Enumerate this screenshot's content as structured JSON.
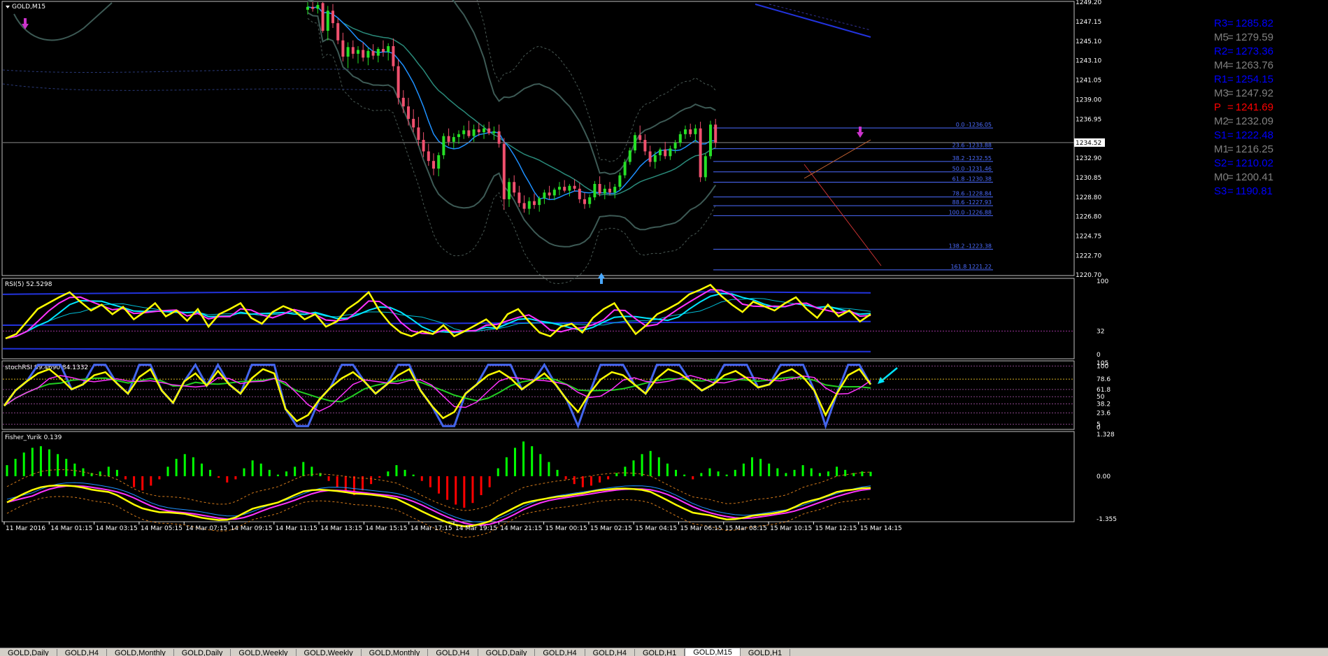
{
  "window": {
    "symbol_label": "GOLD,M15"
  },
  "colors": {
    "background": "#000000",
    "bull_candle": "#26e026",
    "bear_candle": "#f0506e",
    "panel_border": "#c0c0c0",
    "fib": "#4c6cff",
    "pivot_r": "#0000ff",
    "pivot_m": "#808080",
    "pivot_p": "#ff0000",
    "rsi_main": "#ffff00",
    "hist_pos": "#00ff00",
    "hist_neg": "#ff0000"
  },
  "chart_data": [
    {
      "type": "candlestick",
      "title": "GOLD,M15",
      "ylim": [
        1220.7,
        1249.2
      ],
      "y_ticks": [
        "1249.20",
        "1247.15",
        "1245.10",
        "1243.10",
        "1241.05",
        "1239.00",
        "1236.95",
        "1234.52",
        "1232.90",
        "1230.85",
        "1228.80",
        "1226.80",
        "1224.75",
        "1222.70",
        "1220.70"
      ],
      "current_price": "1234.52",
      "grid": false,
      "fib_levels": [
        {
          "label": "0.0 -1236.05",
          "value": 1236.05
        },
        {
          "label": "23.6 -1233.88",
          "value": 1233.88
        },
        {
          "label": "38.2 -1232.55",
          "value": 1232.55
        },
        {
          "label": "50.0 -1231.46",
          "value": 1231.46
        },
        {
          "label": "61.8 -1230.38",
          "value": 1230.38
        },
        {
          "label": "78.6 -1228.84",
          "value": 1228.84
        },
        {
          "label": "88.6 -1227.93",
          "value": 1227.93
        },
        {
          "label": "100.0 -1226.88",
          "value": 1226.88
        },
        {
          "label": "138.2 -1223.38",
          "value": 1223.38
        },
        {
          "label": "161.8 1221.22",
          "value": 1221.22
        }
      ],
      "pivots": [
        {
          "name": "R3",
          "value": "1285.82",
          "kind": "r"
        },
        {
          "name": "M5",
          "value": "1279.59",
          "kind": "m"
        },
        {
          "name": "R2",
          "value": "1273.36",
          "kind": "r"
        },
        {
          "name": "M4",
          "value": "1263.76",
          "kind": "m"
        },
        {
          "name": "R1",
          "value": "1254.15",
          "kind": "r"
        },
        {
          "name": "M3",
          "value": "1247.92",
          "kind": "m"
        },
        {
          "name": "P",
          "value": "1241.69",
          "kind": "p"
        },
        {
          "name": "M2",
          "value": "1232.09",
          "kind": "m"
        },
        {
          "name": "S1",
          "value": "1222.48",
          "kind": "r"
        },
        {
          "name": "M1",
          "value": "1216.25",
          "kind": "m"
        },
        {
          "name": "S2",
          "value": "1210.02",
          "kind": "r"
        },
        {
          "name": "M0",
          "value": "1200.41",
          "kind": "m"
        },
        {
          "name": "S3",
          "value": "1190.81",
          "kind": "r"
        }
      ],
      "candles": [
        [
          1248.4,
          1249.2,
          1247.9,
          1248.7
        ],
        [
          1248.7,
          1249.2,
          1248.2,
          1248.5
        ],
        [
          1248.5,
          1249.2,
          1248.0,
          1248.9
        ],
        [
          1249.1,
          1249.2,
          1246.0,
          1246.2
        ],
        [
          1246.2,
          1248.8,
          1245.2,
          1248.3
        ],
        [
          1248.3,
          1249.0,
          1246.5,
          1247.0
        ],
        [
          1247.0,
          1247.5,
          1244.8,
          1245.2
        ],
        [
          1245.2,
          1246.0,
          1243.0,
          1243.5
        ],
        [
          1243.5,
          1245.0,
          1242.3,
          1244.5
        ],
        [
          1244.5,
          1245.2,
          1243.3,
          1243.8
        ],
        [
          1243.8,
          1244.6,
          1242.8,
          1244.2
        ],
        [
          1244.2,
          1245.0,
          1243.0,
          1243.4
        ],
        [
          1243.4,
          1244.4,
          1242.6,
          1244.1
        ],
        [
          1244.1,
          1244.8,
          1243.2,
          1243.6
        ],
        [
          1243.6,
          1244.5,
          1242.9,
          1244.3
        ],
        [
          1244.3,
          1245.2,
          1243.5,
          1244.0
        ],
        [
          1244.0,
          1244.9,
          1243.1,
          1244.6
        ],
        [
          1244.6,
          1245.4,
          1242.0,
          1242.5
        ],
        [
          1242.5,
          1243.2,
          1238.5,
          1239.2
        ],
        [
          1239.2,
          1240.0,
          1237.6,
          1238.3
        ],
        [
          1238.3,
          1239.2,
          1236.3,
          1237.0
        ],
        [
          1237.0,
          1238.0,
          1235.6,
          1236.1
        ],
        [
          1236.1,
          1237.2,
          1234.2,
          1234.8
        ],
        [
          1234.8,
          1235.6,
          1233.0,
          1233.6
        ],
        [
          1233.6,
          1234.4,
          1232.1,
          1232.6
        ],
        [
          1232.6,
          1233.4,
          1231.1,
          1231.8
        ],
        [
          1231.8,
          1233.5,
          1231.0,
          1233.2
        ],
        [
          1233.2,
          1235.5,
          1232.8,
          1235.2
        ],
        [
          1235.2,
          1236.0,
          1234.2,
          1234.6
        ],
        [
          1234.6,
          1235.5,
          1233.9,
          1235.1
        ],
        [
          1235.1,
          1235.8,
          1234.4,
          1235.4
        ],
        [
          1235.4,
          1236.3,
          1234.9,
          1235.8
        ],
        [
          1235.8,
          1236.8,
          1235.0,
          1235.2
        ],
        [
          1235.2,
          1236.4,
          1234.6,
          1235.9
        ],
        [
          1235.9,
          1236.6,
          1235.2,
          1235.6
        ],
        [
          1235.6,
          1236.4,
          1234.9,
          1236.0
        ],
        [
          1236.0,
          1236.7,
          1235.3,
          1235.5
        ],
        [
          1235.5,
          1236.2,
          1234.8,
          1235.7
        ],
        [
          1235.7,
          1236.4,
          1234.0,
          1234.4
        ],
        [
          1234.4,
          1235.0,
          1227.5,
          1228.6
        ],
        [
          1228.6,
          1230.8,
          1227.8,
          1230.4
        ],
        [
          1230.4,
          1231.1,
          1228.9,
          1229.3
        ],
        [
          1229.3,
          1230.0,
          1227.8,
          1228.2
        ],
        [
          1228.2,
          1229.0,
          1227.2,
          1227.6
        ],
        [
          1227.6,
          1228.8,
          1227.0,
          1228.4
        ],
        [
          1228.4,
          1229.2,
          1227.6,
          1228.0
        ],
        [
          1228.0,
          1228.9,
          1227.3,
          1228.7
        ],
        [
          1228.7,
          1229.6,
          1228.1,
          1229.3
        ],
        [
          1229.3,
          1230.0,
          1228.6,
          1229.0
        ],
        [
          1229.0,
          1229.8,
          1228.5,
          1229.6
        ],
        [
          1229.6,
          1230.4,
          1229.0,
          1229.9
        ],
        [
          1229.9,
          1230.6,
          1229.3,
          1229.5
        ],
        [
          1229.5,
          1230.2,
          1228.9,
          1230.0
        ],
        [
          1230.0,
          1230.7,
          1229.4,
          1229.7
        ],
        [
          1229.7,
          1230.3,
          1228.2,
          1228.6
        ],
        [
          1228.6,
          1229.3,
          1227.6,
          1228.1
        ],
        [
          1228.1,
          1229.1,
          1227.7,
          1228.8
        ],
        [
          1228.8,
          1230.5,
          1228.5,
          1230.2
        ],
        [
          1230.2,
          1231.0,
          1228.9,
          1229.2
        ],
        [
          1229.2,
          1230.1,
          1228.6,
          1229.7
        ],
        [
          1229.7,
          1230.4,
          1229.0,
          1229.3
        ],
        [
          1229.3,
          1230.2,
          1228.7,
          1229.9
        ],
        [
          1229.9,
          1231.4,
          1229.5,
          1231.1
        ],
        [
          1231.1,
          1232.8,
          1230.8,
          1232.5
        ],
        [
          1232.5,
          1234.0,
          1232.2,
          1233.7
        ],
        [
          1233.7,
          1235.6,
          1233.4,
          1235.3
        ],
        [
          1235.3,
          1236.3,
          1234.5,
          1234.8
        ],
        [
          1234.8,
          1235.4,
          1233.2,
          1233.6
        ],
        [
          1233.6,
          1234.2,
          1232.0,
          1232.5
        ],
        [
          1232.5,
          1233.6,
          1231.8,
          1233.2
        ],
        [
          1233.2,
          1234.0,
          1232.6,
          1233.8
        ],
        [
          1233.8,
          1234.6,
          1232.8,
          1233.1
        ],
        [
          1233.1,
          1234.2,
          1232.7,
          1233.9
        ],
        [
          1233.9,
          1234.8,
          1233.4,
          1234.5
        ],
        [
          1234.5,
          1235.7,
          1234.1,
          1235.4
        ],
        [
          1235.4,
          1236.3,
          1234.9,
          1235.9
        ],
        [
          1235.9,
          1236.5,
          1235.1,
          1235.4
        ],
        [
          1235.4,
          1236.4,
          1234.6,
          1236.0
        ],
        [
          1236.0,
          1236.7,
          1230.4,
          1230.9
        ],
        [
          1230.9,
          1233.4,
          1230.5,
          1233.1
        ],
        [
          1233.1,
          1236.8,
          1232.8,
          1236.4
        ],
        [
          1236.4,
          1237.0,
          1234.0,
          1234.5
        ]
      ],
      "x_labels": [
        "11 Mar 2016",
        "14 Mar 01:15",
        "14 Mar 03:15",
        "14 Mar 05:15",
        "14 Mar 07:15",
        "14 Mar 09:15",
        "14 Mar 11:15",
        "14 Mar 13:15",
        "14 Mar 15:15",
        "14 Mar 17:15",
        "14 Mar 19:15",
        "14 Mar 21:15",
        "15 Mar 00:15",
        "15 Mar 02:15",
        "15 Mar 04:15",
        "15 Mar 06:15",
        "15 Mar 08:15",
        "15 Mar 10:15",
        "15 Mar 12:15",
        "15 Mar 14:15"
      ]
    },
    {
      "type": "line",
      "title": "RSI(5) 52.5298",
      "ylim": [
        0,
        100
      ],
      "y_ticks": [
        "100",
        "32",
        "0"
      ],
      "level": 32,
      "values": [
        22,
        28,
        45,
        62,
        70,
        78,
        85,
        72,
        60,
        68,
        55,
        65,
        48,
        58,
        70,
        52,
        60,
        46,
        62,
        38,
        55,
        62,
        70,
        50,
        42,
        58,
        66,
        60,
        48,
        55,
        38,
        45,
        62,
        72,
        85,
        60,
        42,
        30,
        25,
        32,
        28,
        40,
        25,
        32,
        40,
        48,
        35,
        55,
        62,
        45,
        30,
        25,
        38,
        42,
        30,
        50,
        62,
        70,
        48,
        28,
        40,
        55,
        62,
        70,
        82,
        88,
        95,
        80,
        68,
        58,
        72,
        66,
        60,
        70,
        78,
        62,
        50,
        68,
        52,
        60,
        45,
        55
      ]
    },
    {
      "type": "line",
      "title": "stochRSI 89.4690 84.1332",
      "ylim": [
        0,
        105
      ],
      "y_ticks": [
        "105",
        "100",
        "78.6",
        "61.8",
        "50",
        "38.2",
        "23.6",
        "5",
        "0"
      ],
      "values": [
        35,
        60,
        75,
        88,
        95,
        80,
        62,
        70,
        85,
        90,
        72,
        55,
        82,
        95,
        60,
        40,
        75,
        88,
        68,
        92,
        70,
        55,
        80,
        95,
        88,
        30,
        10,
        20,
        45,
        65,
        80,
        90,
        75,
        55,
        70,
        85,
        95,
        60,
        35,
        15,
        25,
        55,
        70,
        85,
        92,
        80,
        62,
        75,
        88,
        70,
        45,
        25,
        55,
        78,
        90,
        85,
        70,
        55,
        80,
        95,
        88,
        75,
        60,
        70,
        85,
        92,
        80,
        65,
        70,
        88,
        95,
        82,
        60,
        20,
        55,
        85,
        95,
        70
      ]
    },
    {
      "type": "bar",
      "title": "Fisher_Yurik 0.139",
      "ylim": [
        -1.355,
        1.328
      ],
      "y_ticks": [
        "1.328",
        "0.00",
        "-1.355"
      ],
      "values": [
        0.35,
        0.55,
        0.75,
        0.9,
        0.95,
        0.85,
        0.7,
        0.55,
        0.4,
        0.25,
        0.1,
        0.15,
        0.3,
        0.2,
        -0.1,
        -0.35,
        -0.45,
        -0.3,
        -0.1,
        0.3,
        0.55,
        0.7,
        0.6,
        0.4,
        0.2,
        -0.05,
        -0.2,
        -0.1,
        0.25,
        0.5,
        0.4,
        0.2,
        0.05,
        0.15,
        0.3,
        0.45,
        0.3,
        0.1,
        -0.15,
        -0.35,
        -0.5,
        -0.6,
        -0.45,
        -0.25,
        -0.05,
        0.15,
        0.35,
        0.2,
        0.05,
        -0.15,
        -0.35,
        -0.55,
        -0.75,
        -0.9,
        -1.0,
        -0.85,
        -0.6,
        -0.35,
        0.25,
        0.6,
        0.9,
        1.1,
        0.95,
        0.7,
        0.45,
        0.2,
        -0.1,
        -0.25,
        -0.35,
        -0.3,
        -0.2,
        -0.1,
        0.1,
        0.3,
        0.5,
        0.7,
        0.8,
        0.6,
        0.4,
        0.2,
        0.05,
        -0.1,
        0.1,
        0.25,
        0.15,
        0.05,
        0.2,
        0.4,
        0.6,
        0.55,
        0.4,
        0.25,
        0.1,
        0.2,
        0.35,
        0.25,
        0.1,
        0.15,
        0.3,
        0.2,
        0.1,
        0.15,
        0.139
      ]
    }
  ],
  "tabs": [
    {
      "label": "GOLD,Daily",
      "active": false
    },
    {
      "label": "GOLD,H4",
      "active": false
    },
    {
      "label": "GOLD,Monthly",
      "active": false
    },
    {
      "label": "GOLD,Daily",
      "active": false
    },
    {
      "label": "GOLD,Weekly",
      "active": false
    },
    {
      "label": "GOLD,Weekly",
      "active": false
    },
    {
      "label": "GOLD,Monthly",
      "active": false
    },
    {
      "label": "GOLD,H4",
      "active": false
    },
    {
      "label": "GOLD,Daily",
      "active": false
    },
    {
      "label": "GOLD,H4",
      "active": false
    },
    {
      "label": "GOLD,H4",
      "active": false
    },
    {
      "label": "GOLD,H1",
      "active": false
    },
    {
      "label": "GOLD,M15",
      "active": true
    },
    {
      "label": "GOLD,H1",
      "active": false
    }
  ]
}
